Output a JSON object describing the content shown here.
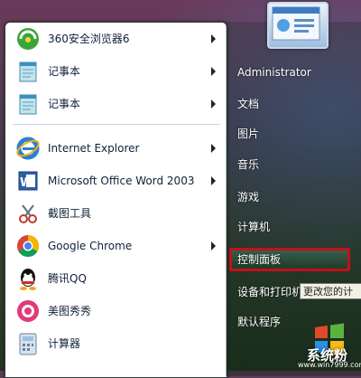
{
  "start_menu": {
    "programs": [
      {
        "label": "360安全浏览器6",
        "icon": "360-browser-icon",
        "has_submenu": true
      },
      {
        "label": "记事本",
        "icon": "notepad-icon",
        "has_submenu": true
      },
      {
        "label": "记事本",
        "icon": "notepad-icon",
        "has_submenu": true
      },
      {
        "label": "Internet Explorer",
        "icon": "internet-explorer-icon",
        "has_submenu": true
      },
      {
        "label": "Microsoft Office Word 2003",
        "icon": "word-icon",
        "has_submenu": true
      },
      {
        "label": "截图工具",
        "icon": "snipping-tool-icon",
        "has_submenu": false
      },
      {
        "label": "Google Chrome",
        "icon": "chrome-icon",
        "has_submenu": true
      },
      {
        "label": "腾讯QQ",
        "icon": "qq-icon",
        "has_submenu": false
      },
      {
        "label": "美图秀秀",
        "icon": "meitu-icon",
        "has_submenu": false
      },
      {
        "label": "计算器",
        "icon": "calculator-icon",
        "has_submenu": false
      }
    ],
    "right_pane": {
      "items": [
        "Administrator",
        "文档",
        "图片",
        "音乐",
        "游戏",
        "计算机",
        "控制面板",
        "设备和打印机",
        "默认程序"
      ],
      "highlighted": "控制面板",
      "tooltip": "更改您的计"
    }
  },
  "watermark": {
    "site": "系统粉",
    "url": "www.win7999.com"
  },
  "colors": {
    "highlight_border": "#c2101c",
    "menu_text": "#10213a"
  }
}
